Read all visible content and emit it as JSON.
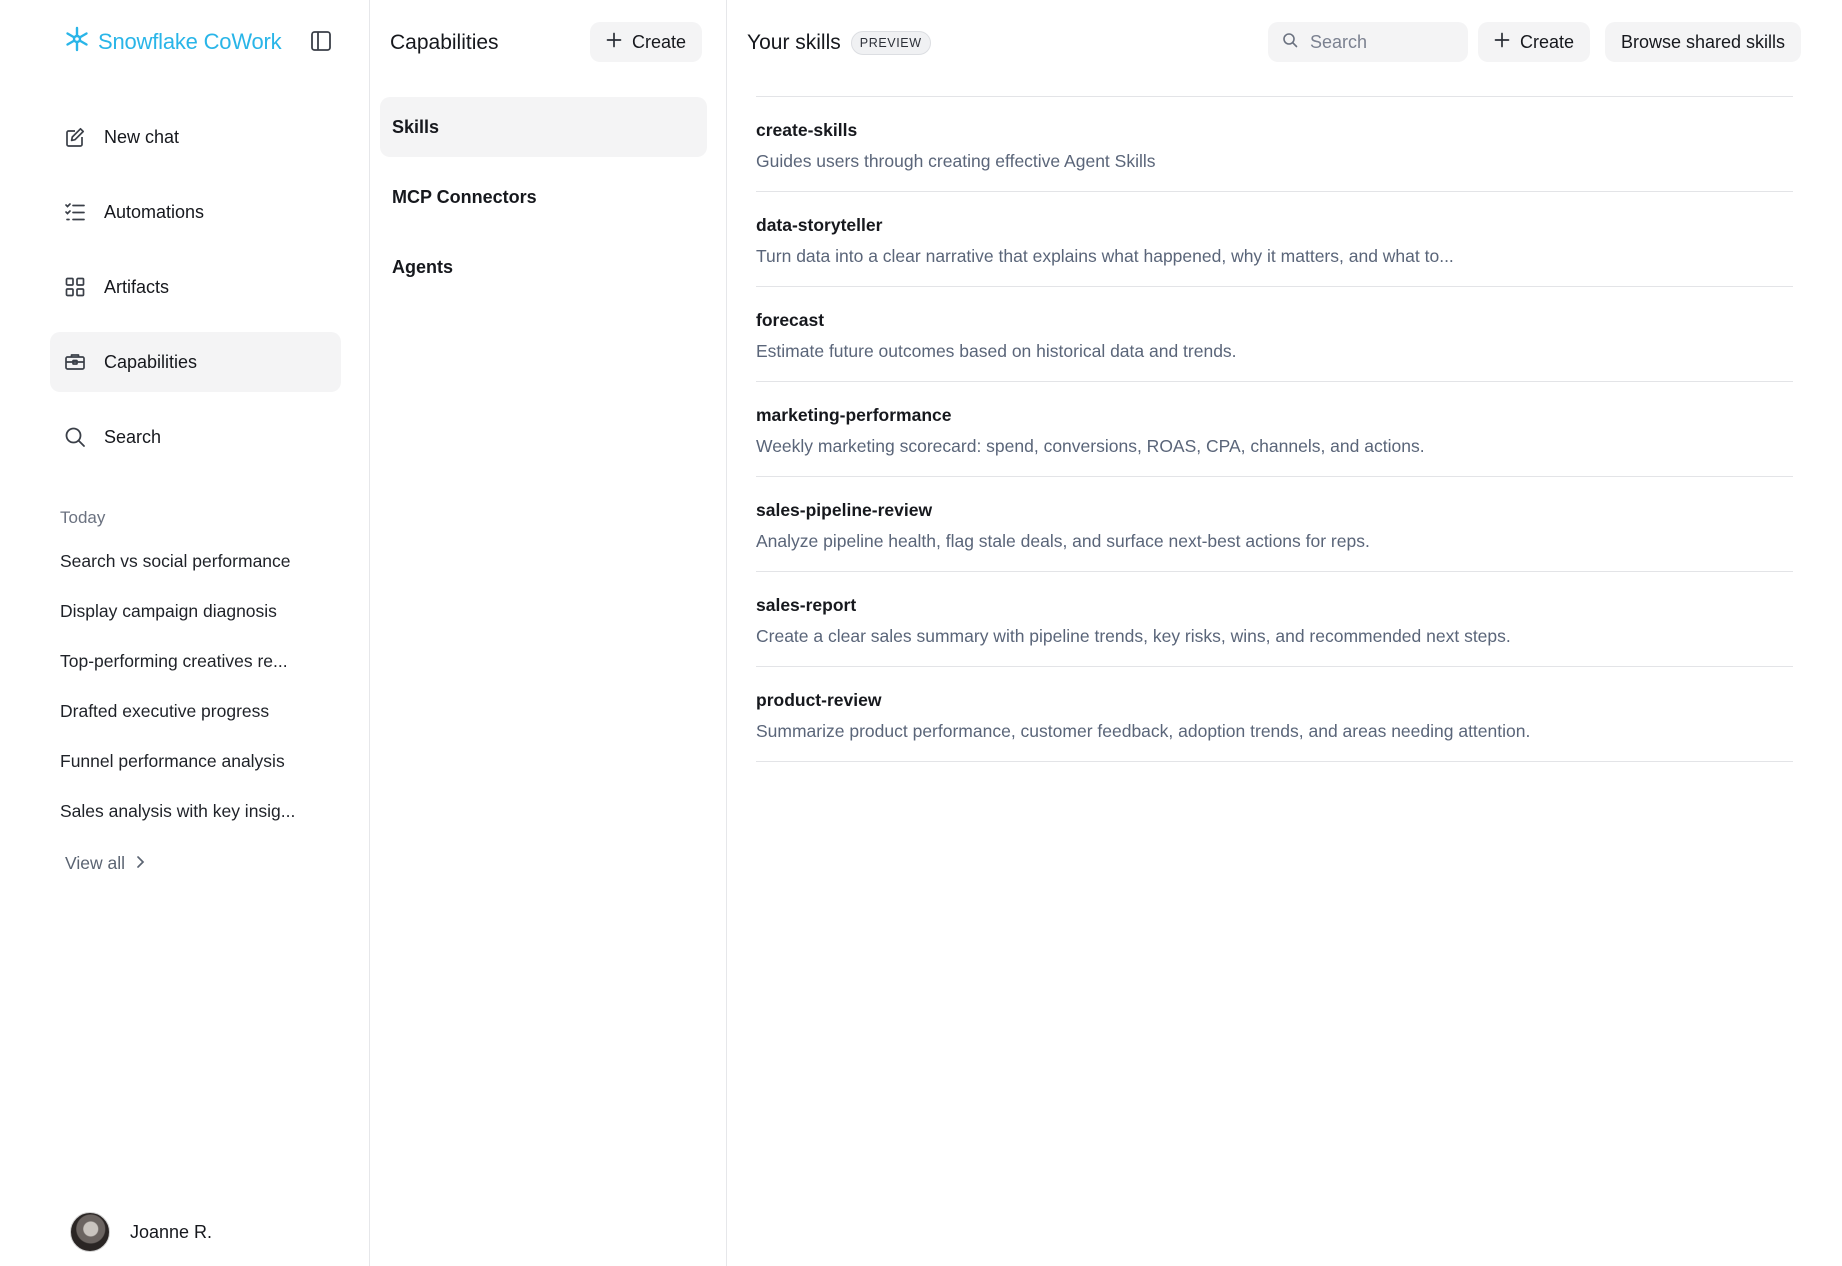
{
  "brand": {
    "name": "Snowflake CoWork",
    "color": "#29b5e8"
  },
  "sidebar": {
    "nav": [
      {
        "label": "New chat",
        "icon": "edit-icon"
      },
      {
        "label": "Automations",
        "icon": "checklist-icon"
      },
      {
        "label": "Artifacts",
        "icon": "grid-icon"
      },
      {
        "label": "Capabilities",
        "icon": "toolbox-icon",
        "active": true
      },
      {
        "label": "Search",
        "icon": "search-icon"
      }
    ],
    "recents_title": "Today",
    "recents": [
      "Search vs social performance",
      "Display campaign diagnosis",
      "Top-performing creatives re...",
      "Drafted executive progress",
      "Funnel performance analysis",
      "Sales analysis with key insig..."
    ],
    "view_all": "View all"
  },
  "user": {
    "name": "Joanne R."
  },
  "capabilities": {
    "title": "Capabilities",
    "create_label": "Create",
    "items": [
      {
        "label": "Skills",
        "active": true
      },
      {
        "label": "MCP Connectors"
      },
      {
        "label": "Agents"
      }
    ]
  },
  "main": {
    "title": "Your skills",
    "badge": "PREVIEW",
    "search_placeholder": "Search",
    "create_label": "Create",
    "browse_label": "Browse shared skills",
    "skills": [
      {
        "name": "create-skills",
        "description": "Guides users through creating effective Agent Skills"
      },
      {
        "name": "data-storyteller",
        "description": "Turn data into a clear narrative that explains what happened, why it matters, and what to..."
      },
      {
        "name": "forecast",
        "description": "Estimate future outcomes based on historical data and trends."
      },
      {
        "name": "marketing-performance",
        "description": "Weekly marketing scorecard: spend, conversions, ROAS, CPA, channels, and actions."
      },
      {
        "name": "sales-pipeline-review",
        "description": "Analyze pipeline health, flag stale deals, and surface next-best actions for reps."
      },
      {
        "name": "sales-report",
        "description": "Create a clear sales summary with pipeline trends, key risks, wins, and recommended next steps."
      },
      {
        "name": "product-review",
        "description": "Summarize product performance, customer feedback, adoption trends, and areas needing attention."
      }
    ]
  }
}
